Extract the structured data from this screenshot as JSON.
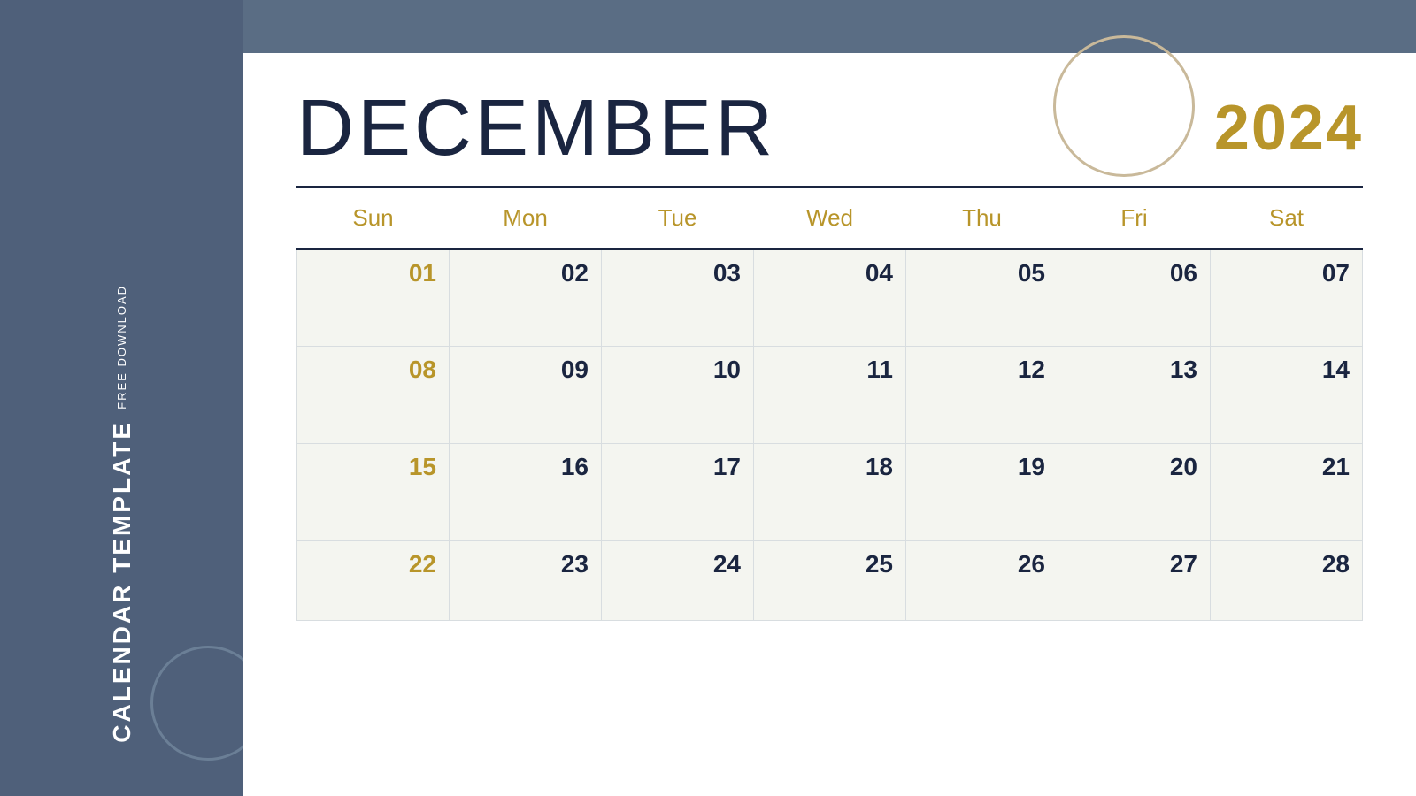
{
  "sidebar": {
    "free_download_label": "FREE DOWNLOAD",
    "calendar_template_label": "CALENDAR TEMPLATE"
  },
  "calendar": {
    "month": "DECEMBER",
    "year": "2024",
    "days_header": [
      "Sun",
      "Mon",
      "Tue",
      "Wed",
      "Thu",
      "Fri",
      "Sat"
    ],
    "weeks": [
      [
        "01",
        "02",
        "03",
        "04",
        "05",
        "06",
        "07"
      ],
      [
        "08",
        "09",
        "10",
        "11",
        "12",
        "13",
        "14"
      ],
      [
        "15",
        "16",
        "17",
        "18",
        "19",
        "20",
        "21"
      ],
      [
        "22",
        "23",
        "24",
        "25",
        "26",
        "27",
        "28"
      ]
    ],
    "sunday_dates": [
      "01",
      "08",
      "15",
      "22"
    ]
  }
}
